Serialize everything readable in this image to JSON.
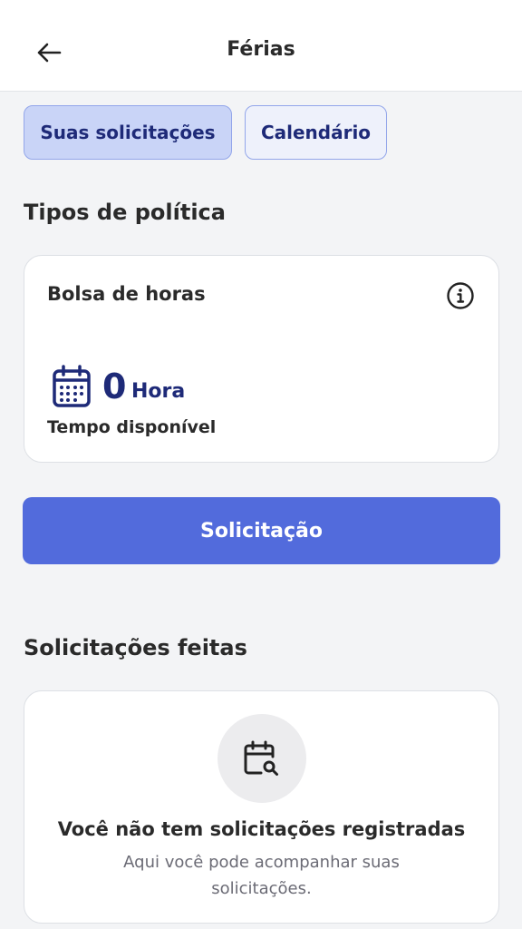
{
  "header": {
    "title": "Férias",
    "back_icon": "arrow-left-icon"
  },
  "tabs": [
    {
      "label": "Suas solicitações",
      "active": true
    },
    {
      "label": "Calendário",
      "active": false
    }
  ],
  "policies": {
    "title": "Tipos de política",
    "card": {
      "name": "Bolsa de horas",
      "info_icon": "info-icon",
      "calendar_icon": "calendar-icon",
      "amount": "0",
      "unit": "Hora",
      "available_label": "Tempo disponível"
    }
  },
  "request_button": {
    "label": "Solicitação"
  },
  "requests": {
    "title": "Solicitações feitas",
    "empty": {
      "icon": "calendar-search-icon",
      "title": "Você não tem solicitações registradas",
      "description": "Aqui você pode acompanhar suas solicitações."
    }
  },
  "colors": {
    "primary": "#526bdc",
    "accent_text": "#1e2a78",
    "tab_active_bg": "#c9d4f7",
    "background": "#f3f4f6"
  }
}
